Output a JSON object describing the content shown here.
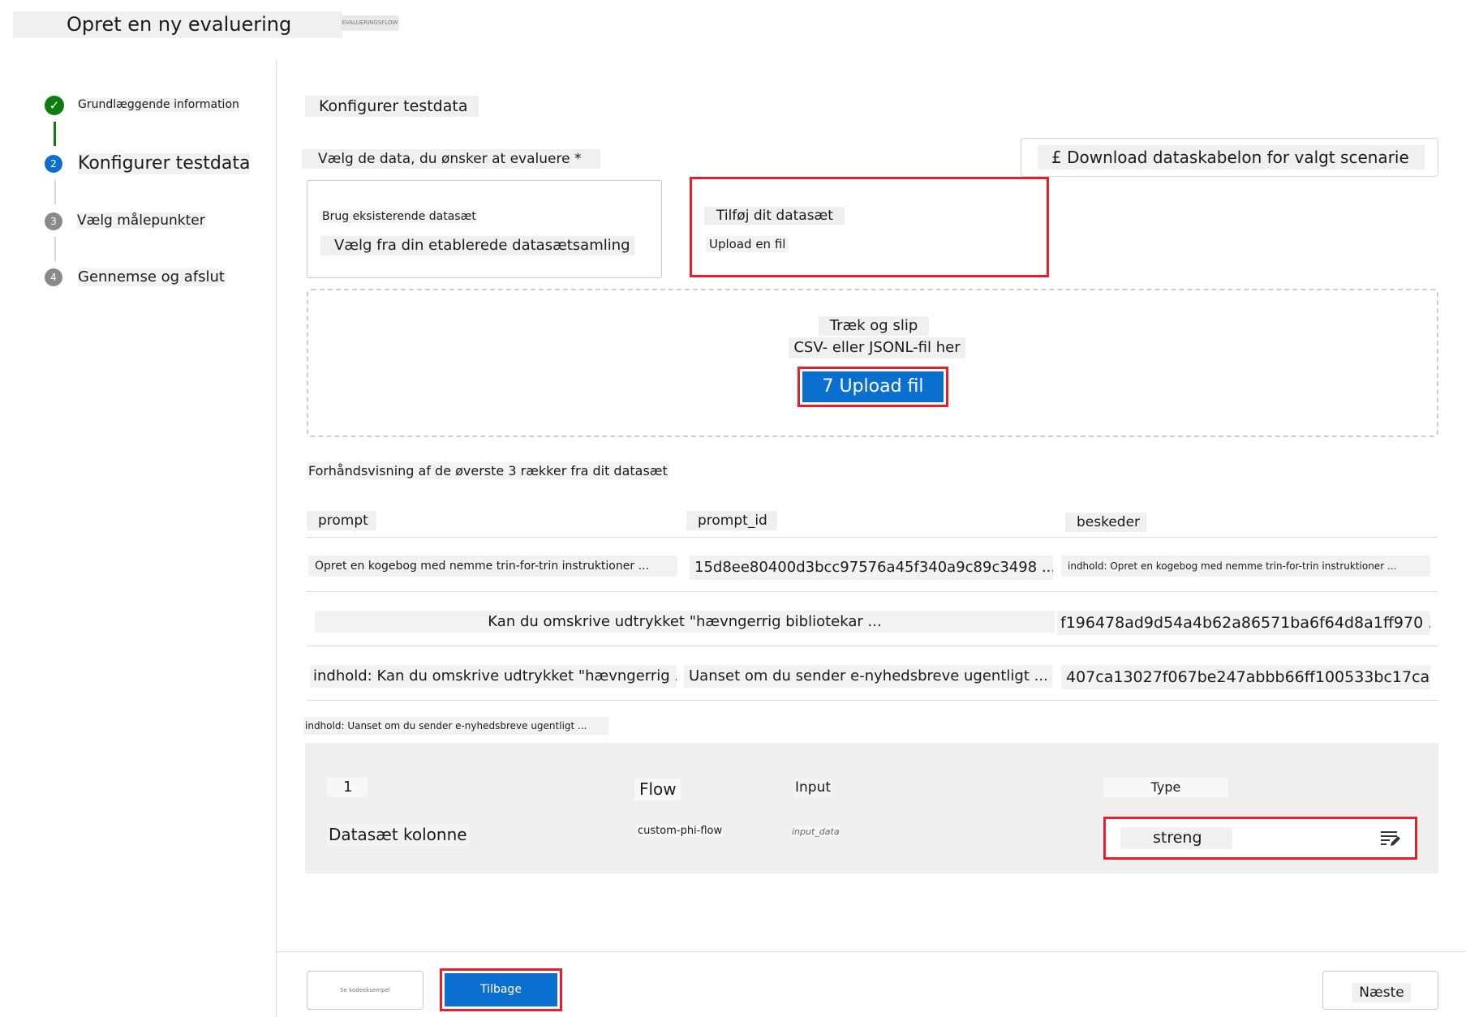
{
  "header": {
    "title": "Opret en ny evaluering",
    "tag": "EVALUERINGSFLOW"
  },
  "stepper": {
    "steps": [
      {
        "number": "✓",
        "label": "Grundlæggende information",
        "state": "completed"
      },
      {
        "number": "2",
        "label": "Konfigurer testdata",
        "state": "current"
      },
      {
        "number": "3",
        "label": "Vælg målepunkter",
        "state": "upcoming"
      },
      {
        "number": "4",
        "label": "Gennemse og afslut",
        "state": "upcoming"
      }
    ]
  },
  "main": {
    "section_title": "Konfigurer testdata",
    "choose_label": "Vælg de data, du ønsker at evaluere *",
    "download_button": "£ Download dataskabelon for valgt scenarie",
    "card_existing": {
      "title": "Brug eksisterende datasæt",
      "subtitle": "Vælg fra din etablerede datasætsamling"
    },
    "card_upload": {
      "title": "Tilføj dit datasæt",
      "subtitle": "Upload en fil"
    },
    "dropzone": {
      "line1": "Træk og slip",
      "line2": "CSV- eller JSONL-fil her",
      "button": "7 Upload fil"
    },
    "preview": {
      "title": "Forhåndsvisning af de øverste 3 rækker fra dit datasæt",
      "columns": [
        "prompt",
        "prompt_id",
        "beskeder"
      ],
      "row1": {
        "prompt": "Opret en kogebog med nemme trin-for-trin instruktioner ...",
        "prompt_id": "15d8ee80400d3bcc97576a45f340a9c89c3498 ...",
        "beskeder": "indhold: Opret en kogebog med nemme trin-for-trin instruktioner ..."
      },
      "row2": {
        "prompt": "Kan du omskrive udtrykket \"hævngerrig bibliotekar ...",
        "prompt_id": "f196478ad9d54a4b62a86571ba6f64d8a1ff970 ..."
      },
      "row3": {
        "beskeder": "indhold: Kan du omskrive udtrykket \"hævngerrig ...",
        "prompt": "Uanset om du sender e-nyhedsbreve ugentligt ...",
        "prompt_id": "407ca13027f067be247abbb66ff100533bc17ca ..."
      },
      "overflow": "indhold: Uanset om du sender e-nyhedsbreve ugentligt ..."
    },
    "mapping": {
      "header_number": "1",
      "header_flow": "Flow",
      "header_input": "Input",
      "header_type": "Type",
      "row_label": "Datasæt kolonne",
      "flow_value": "custom-phi-flow",
      "input_value": "input_data",
      "type_value": "streng",
      "type_icon": "edit-list-icon"
    }
  },
  "footer": {
    "small_button": "Se kodeeksempel",
    "back_button": "Tilbage",
    "next_button": "Næste"
  },
  "colors": {
    "accent_blue": "#0a6fcf",
    "success_green": "#107c10",
    "highlight_red": "#e5202e",
    "step_grey": "#8a8a8a"
  }
}
